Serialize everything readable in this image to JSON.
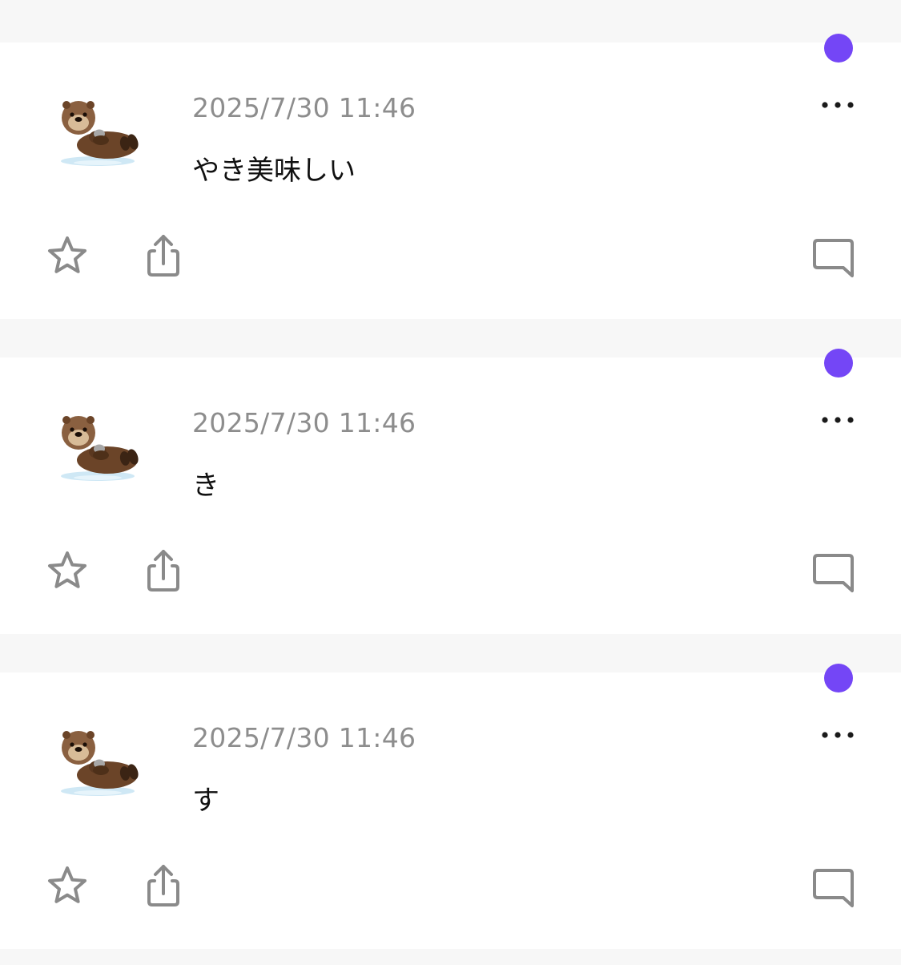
{
  "colors": {
    "background": "#f7f7f7",
    "card": "#ffffff",
    "accent": "#7446f6",
    "timestamp": "#8d8d8d",
    "icon": "#8a8a8a",
    "text": "#111111"
  },
  "icons": {
    "avatar": "sea-otter-emoji",
    "unread": "purple-dot",
    "more": "ellipsis-horizontal",
    "star": "star-outline",
    "share": "share-upload",
    "comment": "speech-bubble"
  },
  "posts": [
    {
      "timestamp": "2025/7/30 11:46",
      "text": "やき美味しい"
    },
    {
      "timestamp": "2025/7/30 11:46",
      "text": "き"
    },
    {
      "timestamp": "2025/7/30 11:46",
      "text": "す"
    }
  ]
}
